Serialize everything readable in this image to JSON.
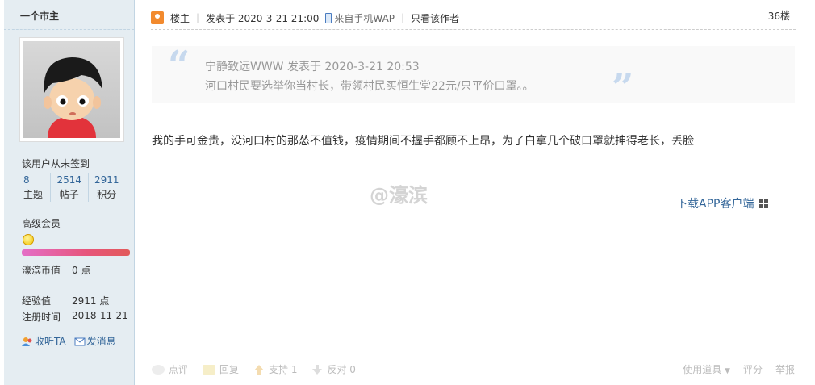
{
  "user": {
    "name": "一个市主",
    "sign_status": "该用户从未签到",
    "stats": [
      {
        "value": "8",
        "label": "主题"
      },
      {
        "value": "2514",
        "label": "帖子"
      },
      {
        "value": "2911",
        "label": "积分"
      }
    ],
    "rank": "高级会员",
    "credits": [
      {
        "label": "濠滨币值",
        "value": "0 点"
      },
      {
        "label": "经验值",
        "value": "2911 点"
      },
      {
        "label": "注册时间",
        "value": "2018-11-21"
      }
    ],
    "follow_label": "收听TA",
    "message_label": "发消息"
  },
  "post": {
    "author_tag": "楼主",
    "posted_at": "发表于 2020-3-21 21:00",
    "source": "来自手机WAP",
    "only_author": "只看该作者",
    "floor": "36楼",
    "quote": {
      "author_line": "宁静致远WWW 发表于 2020-3-21 20:53",
      "text": "河口村民要选举你当村长，带领村民买恒生堂22元/只平价口罩。。"
    },
    "body": "我的手可金贵，没河口村的那怂不值钱，疫情期间不握手都顾不上昂，为了白拿几个破口罩就抻得老长，丢脸",
    "watermark": "@濠滨",
    "app_link": "下载APP客户端"
  },
  "footer": {
    "comment": "点评",
    "reply": "回复",
    "support": "支持 1",
    "oppose": "反对 0",
    "use_tool": "使用道具",
    "rate": "评分",
    "report": "举报"
  }
}
